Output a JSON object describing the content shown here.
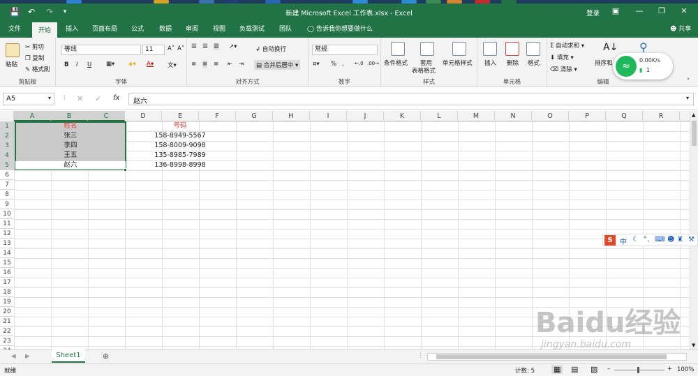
{
  "titlebar": {
    "title": "新建 Microsoft Excel 工作表.xlsx - Excel",
    "login": "登录"
  },
  "tabs": [
    "文件",
    "开始",
    "插入",
    "页面布局",
    "公式",
    "数据",
    "审阅",
    "视图",
    "负载测试",
    "团队"
  ],
  "tellme": "告诉我你想要做什么",
  "share": "共享",
  "ribbon": {
    "clipboard": {
      "paste": "粘贴",
      "cut": "剪切",
      "copy": "复制",
      "format_painter": "格式刷",
      "label": "剪贴板"
    },
    "font": {
      "font_name": "等线",
      "font_size": "11",
      "bold": "B",
      "italic": "I",
      "underline": "U",
      "label": "字体"
    },
    "alignment": {
      "wrap": "自动换行",
      "merge": "合并后居中",
      "label": "对齐方式"
    },
    "number": {
      "format": "常规",
      "percent": "%",
      "comma": ",",
      "label": "数字"
    },
    "styles": {
      "conditional": "条件格式",
      "table_format_1": "套用",
      "table_format_2": "表格格式",
      "cell_styles": "单元格样式",
      "label": "样式"
    },
    "cells": {
      "insert": "插入",
      "delete": "删除",
      "format": "格式",
      "label": "单元格"
    },
    "editing": {
      "autosum": "自动求和",
      "fill": "填充",
      "clear": "清除",
      "sort": "排序和",
      "label": "编辑"
    }
  },
  "formula": {
    "name_box": "A5",
    "content": "赵六"
  },
  "columns": [
    "A",
    "B",
    "C",
    "D",
    "E",
    "F",
    "G",
    "H",
    "I",
    "J",
    "K",
    "L",
    "M",
    "N",
    "O",
    "P",
    "Q",
    "R"
  ],
  "rows": [
    "1",
    "2",
    "3",
    "4",
    "5",
    "6",
    "7",
    "8",
    "9",
    "10",
    "11",
    "12",
    "13",
    "14",
    "15",
    "16",
    "17",
    "18",
    "19",
    "20",
    "21",
    "22",
    "23",
    "24"
  ],
  "sheet": {
    "names": [
      "姓名",
      "张三",
      "李四",
      "王五",
      "赵六"
    ],
    "phones": [
      "号码",
      "158-8949-5567",
      "158-8009-9098",
      "135-8985-7989",
      "136-8998-8998"
    ]
  },
  "sheet_tab": "Sheet1",
  "status": {
    "ready": "就绪",
    "count": "计数: 5",
    "zoom": "100%"
  },
  "network_widget": {
    "speed": "0.00K/s",
    "count": "1"
  },
  "ime": {
    "mode": "中"
  },
  "watermark": {
    "brand": "Baidu经验",
    "url": "jingyan.baidu.com"
  },
  "colors": {
    "excel_green": "#217346",
    "header_red": "#e03b3b",
    "selection": "#c9c9c9"
  }
}
